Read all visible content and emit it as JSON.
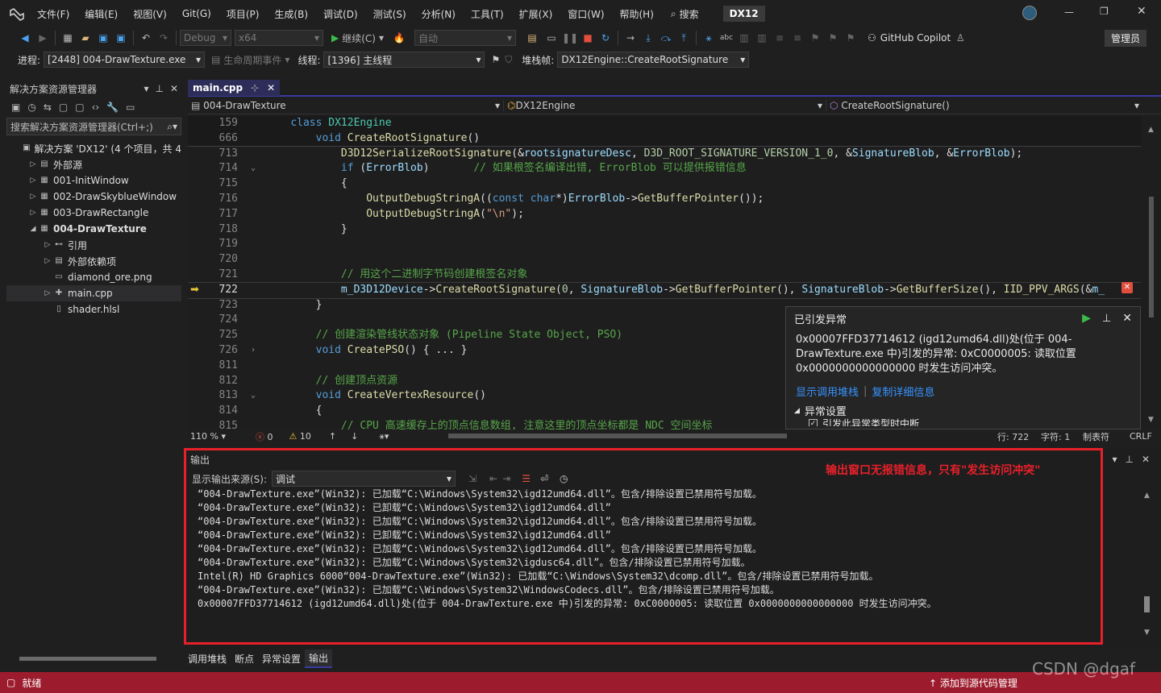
{
  "menubar": {
    "items": [
      "文件(F)",
      "编辑(E)",
      "视图(V)",
      "Git(G)",
      "项目(P)",
      "生成(B)",
      "调试(D)",
      "测试(S)",
      "分析(N)",
      "工具(T)",
      "扩展(X)",
      "窗口(W)",
      "帮助(H)"
    ],
    "search": "搜索",
    "solution_badge": "DX12"
  },
  "toolbar": {
    "config": "Debug",
    "platform": "x64",
    "continue": "继续(C)",
    "auto": "自动",
    "copilot": "GitHub Copilot",
    "admin": "管理员"
  },
  "debugbar": {
    "process_label": "进程:",
    "process": "[2448] 004-DrawTexture.exe",
    "lifecycle": "生命周期事件",
    "thread_label": "线程:",
    "thread": "[1396] 主线程",
    "stack_label": "堆栈帧:",
    "stack": "DX12Engine::CreateRootSignature"
  },
  "solution_explorer": {
    "title": "解决方案资源管理器",
    "search": "搜索解决方案资源管理器(Ctrl+;)",
    "items": [
      {
        "label": "解决方案 'DX12' (4 个项目，共 4",
        "indent": 0,
        "tw": "",
        "bold": false
      },
      {
        "label": "外部源",
        "indent": 1,
        "tw": "▷",
        "bold": false
      },
      {
        "label": "001-InitWindow",
        "indent": 1,
        "tw": "▷",
        "bold": false
      },
      {
        "label": "002-DrawSkyblueWindow",
        "indent": 1,
        "tw": "▷",
        "bold": false
      },
      {
        "label": "003-DrawRectangle",
        "indent": 1,
        "tw": "▷",
        "bold": false
      },
      {
        "label": "004-DrawTexture",
        "indent": 1,
        "tw": "◢",
        "bold": true
      },
      {
        "label": "引用",
        "indent": 2,
        "tw": "▷",
        "bold": false
      },
      {
        "label": "外部依赖项",
        "indent": 2,
        "tw": "▷",
        "bold": false
      },
      {
        "label": "diamond_ore.png",
        "indent": 2,
        "tw": "",
        "bold": false
      },
      {
        "label": "main.cpp",
        "indent": 2,
        "tw": "▷",
        "bold": false
      },
      {
        "label": "shader.hlsl",
        "indent": 2,
        "tw": "",
        "bold": false
      }
    ]
  },
  "editor": {
    "tab": "main.cpp",
    "nav_project": "004-DrawTexture",
    "nav_class": "DX12Engine",
    "nav_member": "CreateRootSignature()",
    "zoom": "110 %",
    "errors": "0",
    "warnings": "10",
    "line": "行: 722",
    "col": "字符: 1",
    "tabs": "制表符",
    "eol": "CRLF",
    "lines": [
      {
        "n": "159",
        "code": "    class DX12Engine"
      },
      {
        "n": "666",
        "code": "        void CreateRootSignature()"
      },
      {
        "n": "713",
        "code": "            D3D12SerializeRootSignature(&rootsignatureDesc, D3D_ROOT_SIGNATURE_VERSION_1_0, &SignatureBlob, &ErrorBlob);"
      },
      {
        "n": "714",
        "code": "            if (ErrorBlob)       // 如果根签名编译出错, ErrorBlob 可以提供报错信息"
      },
      {
        "n": "715",
        "code": "            {"
      },
      {
        "n": "716",
        "code": "                OutputDebugStringA((const char*)ErrorBlob->GetBufferPointer());"
      },
      {
        "n": "717",
        "code": "                OutputDebugStringA(\"\\n\");"
      },
      {
        "n": "718",
        "code": "            }"
      },
      {
        "n": "719",
        "code": ""
      },
      {
        "n": "720",
        "code": ""
      },
      {
        "n": "721",
        "code": "            // 用这个二进制字节码创建根签名对象"
      },
      {
        "n": "722",
        "code": "            m_D3D12Device->CreateRootSignature(0, SignatureBlob->GetBufferPointer(), SignatureBlob->GetBufferSize(), IID_PPV_ARGS(&m_"
      },
      {
        "n": "723",
        "code": "        }"
      },
      {
        "n": "724",
        "code": ""
      },
      {
        "n": "725",
        "code": "        // 创建渲染管线状态对象 (Pipeline State Object, PSO)"
      },
      {
        "n": "726",
        "code": "        void CreatePSO() { ... }"
      },
      {
        "n": "811",
        "code": ""
      },
      {
        "n": "812",
        "code": "        // 创建顶点资源"
      },
      {
        "n": "813",
        "code": "        void CreateVertexResource()"
      },
      {
        "n": "814",
        "code": "        {"
      },
      {
        "n": "815",
        "code": "            // CPU 高速缓存上的顶点信息数组, 注意这里的顶点坐标都是 NDC 空间坐标"
      }
    ]
  },
  "exception": {
    "title": "已引发异常",
    "message": "0x00007FFD37714612 (igd12umd64.dll)处(位于 004-DrawTexture.exe 中)引发的异常: 0xC0000005: 读取位置 0x0000000000000000 时发生访问冲突。",
    "link1": "显示调用堆栈",
    "link2": "复制详细信息",
    "settings": "异常设置",
    "checkbox": "引发此异常类型时中断"
  },
  "output": {
    "title": "输出",
    "source_label": "显示输出来源(S):",
    "source": "调试",
    "annotation": "输出窗口无报错信息，只有\"发生访问冲突\"",
    "lines": [
      "“004-DrawTexture.exe”(Win32): 已加载“C:\\Windows\\System32\\igd12umd64.dll”。包含/排除设置已禁用符号加载。",
      "“004-DrawTexture.exe”(Win32): 已卸载“C:\\Windows\\System32\\igd12umd64.dll”",
      "“004-DrawTexture.exe”(Win32): 已加载“C:\\Windows\\System32\\igd12umd64.dll”。包含/排除设置已禁用符号加载。",
      "“004-DrawTexture.exe”(Win32): 已卸载“C:\\Windows\\System32\\igd12umd64.dll”",
      "“004-DrawTexture.exe”(Win32): 已加载“C:\\Windows\\System32\\igd12umd64.dll”。包含/排除设置已禁用符号加载。",
      "“004-DrawTexture.exe”(Win32): 已加载“C:\\Windows\\System32\\igdusc64.dll”。包含/排除设置已禁用符号加载。",
      "Intel(R) HD Graphics 6000“004-DrawTexture.exe”(Win32): 已加载“C:\\Windows\\System32\\dcomp.dll”。包含/排除设置已禁用符号加载。",
      "“004-DrawTexture.exe”(Win32): 已加载“C:\\Windows\\System32\\WindowsCodecs.dll”。包含/排除设置已禁用符号加载。",
      "0x00007FFD37714612 (igd12umd64.dll)处(位于 004-DrawTexture.exe 中)引发的异常: 0xC0000005: 读取位置 0x0000000000000000 时发生访问冲突。"
    ]
  },
  "bottom_tabs": [
    "调用堆栈",
    "断点",
    "异常设置",
    "输出"
  ],
  "status": {
    "ready": "就绪",
    "source_control": "添加到源代码管理",
    "watermark": "CSDN @dgaf"
  },
  "colors": {
    "status_bar": "#9c1c2d",
    "annotation_red": "#e8202a"
  }
}
